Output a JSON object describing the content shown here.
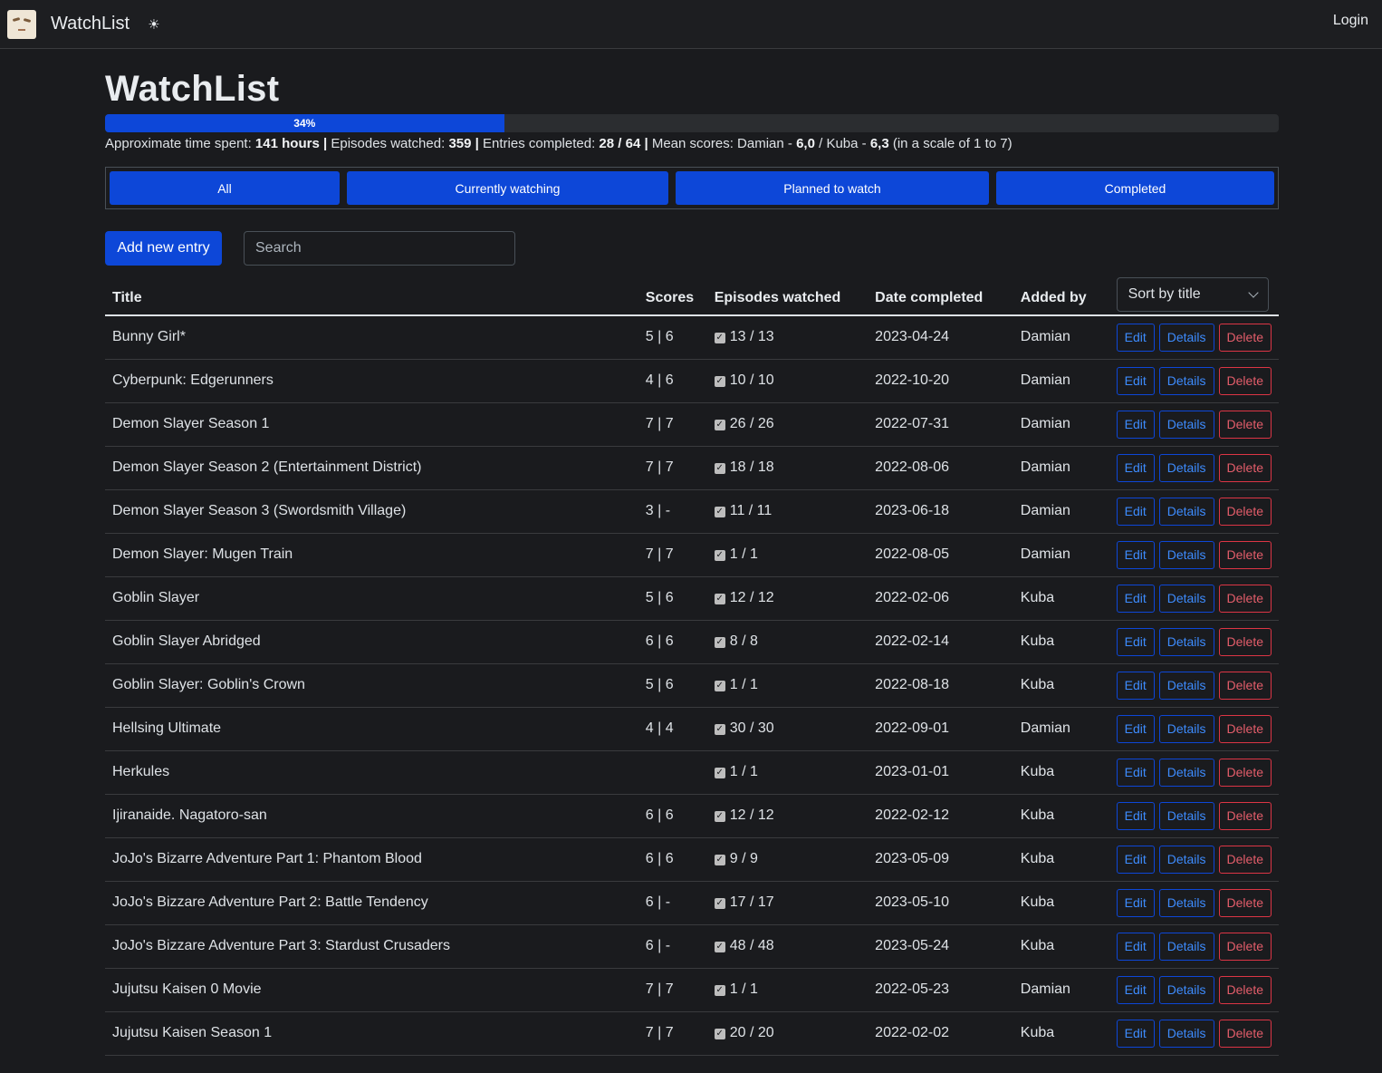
{
  "nav": {
    "brand": "WatchList",
    "theme_icon": "☀",
    "login": "Login"
  },
  "page": {
    "title": "WatchList",
    "progress_label": "34%",
    "progress_value": 0.34,
    "stats": {
      "time_label": "Approximate time spent:",
      "time_value": "141 hours",
      "episodes_label": "Episodes watched:",
      "episodes_value": "359",
      "entries_label": "Entries completed:",
      "entries_value": "28 / 64",
      "mean_label": "Mean scores: Damian -",
      "damian_value": "6,0",
      "kuba_label": "/ Kuba -",
      "kuba_value": "6,3",
      "scale_note": "(in a scale of 1 to 7)"
    },
    "filters": [
      "All",
      "Currently watching",
      "Planned to watch",
      "Completed"
    ],
    "add_button": "Add new entry",
    "search_placeholder": "Search",
    "sort_label": "Sort by title"
  },
  "table": {
    "headers": {
      "title": "Title",
      "scores": "Scores",
      "episodes": "Episodes watched",
      "date": "Date completed",
      "added_by": "Added by"
    },
    "action_labels": {
      "edit": "Edit",
      "details": "Details",
      "delete": "Delete"
    },
    "rows": [
      {
        "title": "Bunny Girl*",
        "scores": "5 | 6",
        "episodes": "13 / 13",
        "date": "2023-04-24",
        "added_by": "Damian"
      },
      {
        "title": "Cyberpunk: Edgerunners",
        "scores": "4 | 6",
        "episodes": "10 / 10",
        "date": "2022-10-20",
        "added_by": "Damian"
      },
      {
        "title": "Demon Slayer Season 1",
        "scores": "7 | 7",
        "episodes": "26 / 26",
        "date": "2022-07-31",
        "added_by": "Damian"
      },
      {
        "title": "Demon Slayer Season 2 (Entertainment District)",
        "scores": "7 | 7",
        "episodes": "18 / 18",
        "date": "2022-08-06",
        "added_by": "Damian"
      },
      {
        "title": "Demon Slayer Season 3 (Swordsmith Village)",
        "scores": "3 | -",
        "episodes": "11 / 11",
        "date": "2023-06-18",
        "added_by": "Damian"
      },
      {
        "title": "Demon Slayer: Mugen Train",
        "scores": "7 | 7",
        "episodes": "1 / 1",
        "date": "2022-08-05",
        "added_by": "Damian"
      },
      {
        "title": "Goblin Slayer",
        "scores": "5 | 6",
        "episodes": "12 / 12",
        "date": "2022-02-06",
        "added_by": "Kuba"
      },
      {
        "title": "Goblin Slayer Abridged",
        "scores": "6 | 6",
        "episodes": "8 / 8",
        "date": "2022-02-14",
        "added_by": "Kuba"
      },
      {
        "title": "Goblin Slayer: Goblin's Crown",
        "scores": "5 | 6",
        "episodes": "1 / 1",
        "date": "2022-08-18",
        "added_by": "Kuba"
      },
      {
        "title": "Hellsing Ultimate",
        "scores": "4 | 4",
        "episodes": "30 / 30",
        "date": "2022-09-01",
        "added_by": "Damian"
      },
      {
        "title": "Herkules",
        "scores": "",
        "episodes": "1 / 1",
        "date": "2023-01-01",
        "added_by": "Kuba"
      },
      {
        "title": "Ijiranaide. Nagatoro-san",
        "scores": "6 | 6",
        "episodes": "12 / 12",
        "date": "2022-02-12",
        "added_by": "Kuba"
      },
      {
        "title": "JoJo's Bizarre Adventure Part 1: Phantom Blood",
        "scores": "6 | 6",
        "episodes": "9 / 9",
        "date": "2023-05-09",
        "added_by": "Kuba"
      },
      {
        "title": "JoJo's Bizzare Adventure Part 2: Battle Tendency",
        "scores": "6 | -",
        "episodes": "17 / 17",
        "date": "2023-05-10",
        "added_by": "Kuba"
      },
      {
        "title": "JoJo's Bizzare Adventure Part 3: Stardust Crusaders",
        "scores": "6 | -",
        "episodes": "48 / 48",
        "date": "2023-05-24",
        "added_by": "Kuba"
      },
      {
        "title": "Jujutsu Kaisen 0 Movie",
        "scores": "7 | 7",
        "episodes": "1 / 1",
        "date": "2022-05-23",
        "added_by": "Damian"
      },
      {
        "title": "Jujutsu Kaisen Season 1",
        "scores": "7 | 7",
        "episodes": "20 / 20",
        "date": "2022-02-02",
        "added_by": "Kuba"
      }
    ]
  }
}
